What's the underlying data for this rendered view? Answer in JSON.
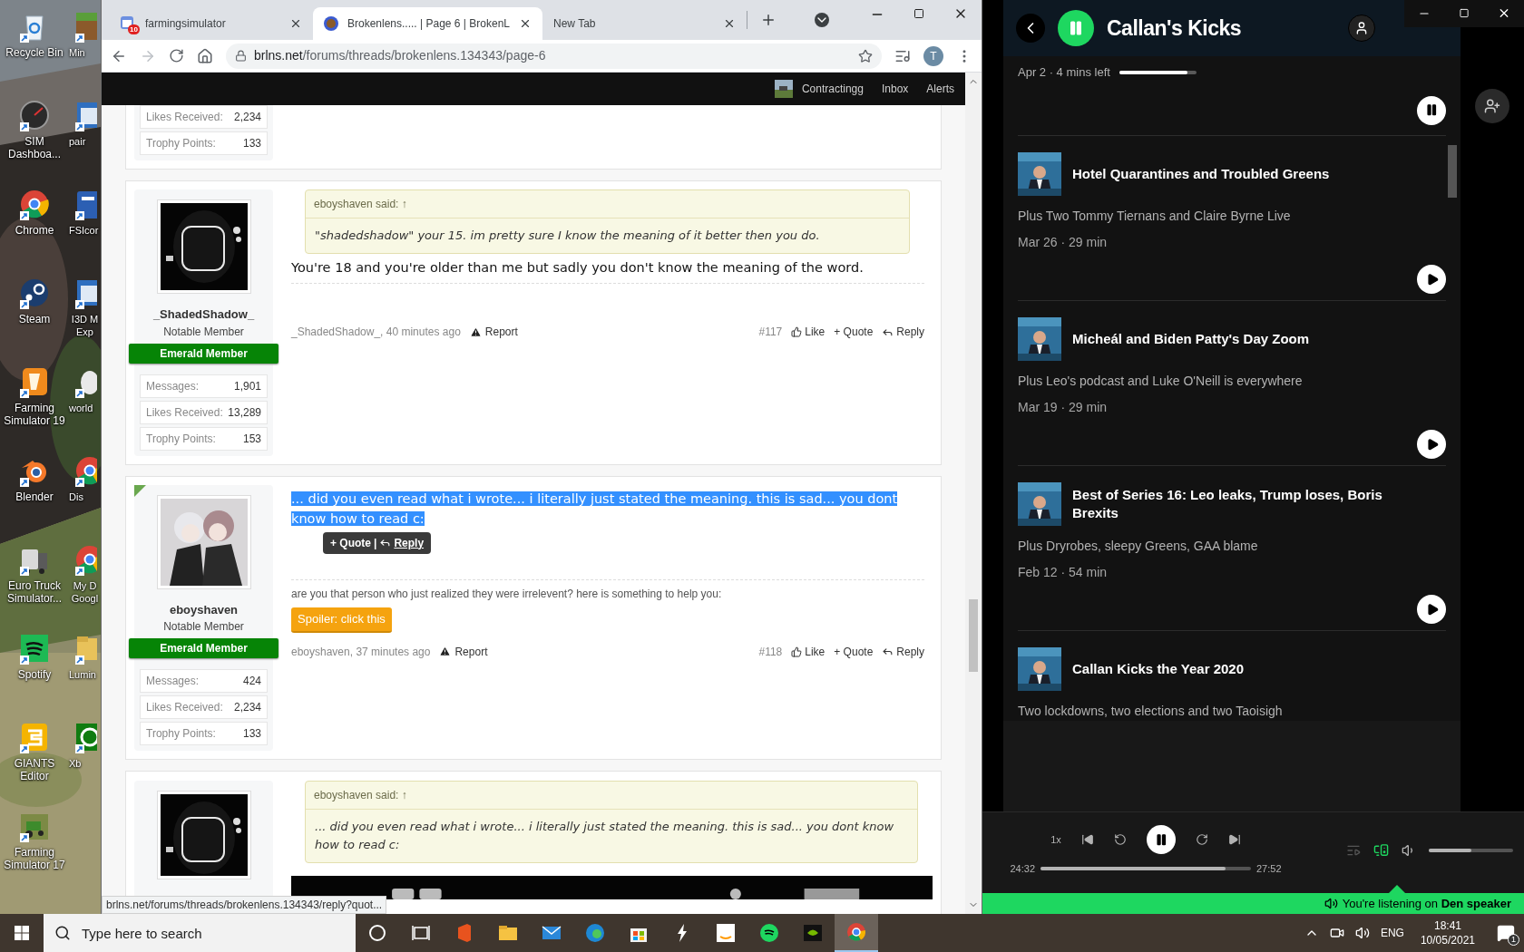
{
  "desktop": {
    "columns": [
      [
        {
          "label": "Recycle Bin",
          "kind": "recycle"
        },
        {
          "label": "SIM Dashboa...",
          "kind": "gauge"
        },
        {
          "label": "Chrome",
          "kind": "chrome"
        },
        {
          "label": "Steam",
          "kind": "steam"
        },
        {
          "label": "Farming Simulator 19",
          "kind": "fs19"
        },
        {
          "label": "Blender",
          "kind": "blender"
        },
        {
          "label": "Euro Truck Simulator...",
          "kind": "truck"
        },
        {
          "label": "Spotify",
          "kind": "spotify"
        },
        {
          "label": "GIANTS Editor",
          "kind": "giants"
        },
        {
          "label": "Farming Simulator 17",
          "kind": "tractor"
        }
      ],
      [
        {
          "label": "Min",
          "kind": "block"
        },
        {
          "label": "pair",
          "kind": "window"
        },
        {
          "label": "FSIcor",
          "kind": "doc"
        },
        {
          "label": "I3D M Exp",
          "kind": "window"
        },
        {
          "label": "world",
          "kind": "mouse"
        },
        {
          "label": "Dis",
          "kind": "chrome"
        },
        {
          "label": "My D Googl",
          "kind": "chrome"
        },
        {
          "label": "Lumin",
          "kind": "folder"
        },
        {
          "label": "Xb",
          "kind": "xbox"
        }
      ]
    ]
  },
  "browser": {
    "tabs": [
      {
        "title": "farmingsimulator",
        "badge": "10",
        "kind": "calendar",
        "selected": false
      },
      {
        "title": "Brokenlens..... | Page 6 | BrokenL",
        "kind": "round",
        "selected": true
      },
      {
        "title": "New Tab",
        "kind": "none",
        "selected": false
      }
    ],
    "address": {
      "domain": "brlns.net",
      "path": "/forums/threads/brokenlens.134343/page-6"
    },
    "profile_initial": "T",
    "site_nav": [
      "Contractingg",
      "Inbox",
      "Alerts"
    ],
    "status_url": "brlns.net/forums/threads/brokenlens.134343/reply?quot..."
  },
  "forum": {
    "posts": [
      {
        "kind": "partial",
        "stats": [
          {
            "label": "Likes Received:",
            "value": "2,234"
          },
          {
            "label": "Trophy Points:",
            "value": "133"
          }
        ]
      },
      {
        "kind": "full",
        "avatar": {
          "kind": "mask"
        },
        "new": false,
        "name": "_ShadedShadow_",
        "title": "Notable Member",
        "banner": "Emerald Member",
        "stats": [
          {
            "label": "Messages:",
            "value": "1,901"
          },
          {
            "label": "Likes Received:",
            "value": "13,289"
          },
          {
            "label": "Trophy Points:",
            "value": "153"
          }
        ],
        "quote": {
          "author": "eboyshaven said: ↑",
          "text": "\"shadedshadow\" your 15. im pretty sure I know the meaning of it better then you do."
        },
        "message": "You're 18 and you're older than me but sadly you don't know the meaning of the word.",
        "selected": false,
        "author_line": "_ShadedShadow_, 40 minutes ago",
        "report": "Report",
        "number": "#117",
        "actions": [
          {
            "kind": "like",
            "label": "Like"
          },
          {
            "kind": "quote",
            "label": "+ Quote"
          },
          {
            "kind": "reply",
            "label": "Reply"
          }
        ]
      },
      {
        "kind": "full",
        "avatar": {
          "kind": "pair"
        },
        "new": true,
        "name": "eboyshaven",
        "title": "Notable Member",
        "banner": "Emerald Member",
        "stats": [
          {
            "label": "Messages:",
            "value": "424"
          },
          {
            "label": "Likes Received:",
            "value": "2,234"
          },
          {
            "label": "Trophy Points:",
            "value": "133"
          }
        ],
        "message": "... did you even read what i wrote... i literally just stated the meaning. this is sad... you dont know how to read c:",
        "selected": true,
        "tooltip": {
          "quote": "+ Quote",
          "separator": "|",
          "reply": "Reply"
        },
        "extra": "are you that person who just realized they were irrelevent? here is something to help you:",
        "spoiler": "Spoiler: click this",
        "author_line": "eboyshaven, 37 minutes ago",
        "report": "Report",
        "number": "#118",
        "actions": [
          {
            "kind": "like",
            "label": "Like"
          },
          {
            "kind": "quote",
            "label": "+ Quote"
          },
          {
            "kind": "reply",
            "label": "Reply"
          }
        ]
      },
      {
        "kind": "cut",
        "avatar": {
          "kind": "mask"
        },
        "quote": {
          "author": "eboyshaven said: ↑",
          "text": "... did you even read what i wrote... i literally just stated the meaning. this is sad... you dont know how to read c:"
        }
      }
    ]
  },
  "spotify": {
    "title": "Callan's Kicks",
    "playing": true,
    "current": {
      "meta": "Apr 2 · 4 mins left",
      "level": 0.88,
      "playing": true
    },
    "episodes": [
      {
        "title": "Hotel Quarantines and Troubled Greens",
        "description": "Plus Two Tommy Tiernans and Claire Byrne Live",
        "meta": "Mar 26 · 29 min"
      },
      {
        "title": "Micheál and Biden Patty's Day Zoom",
        "description": "Plus Leo's podcast and Luke O'Neill is everywhere",
        "meta": "Mar 19 · 29 min"
      },
      {
        "title": "Best of Series 16: Leo leaks, Trump loses, Boris Brexits",
        "description": "Plus Dryrobes, sleepy Greens, GAA blame",
        "meta": "Feb 12 · 54 min"
      },
      {
        "title": "Callan Kicks the Year 2020",
        "description": "Two lockdowns, two elections and two Taoisigh"
      }
    ],
    "player": {
      "speed": "1x",
      "elapsed": "24:32",
      "duration": "27:52",
      "level": 0.88,
      "playing": true,
      "volume": {
        "level": 0.5
      }
    },
    "device_bar": "You're listening on **Den speaker**"
  },
  "taskbar": {
    "search_placeholder": "Type here to search",
    "apps": [
      {
        "kind": "cortana",
        "active": false
      },
      {
        "kind": "taskview",
        "active": false
      },
      {
        "kind": "office",
        "active": false
      },
      {
        "kind": "explorer",
        "active": false
      },
      {
        "kind": "mail",
        "active": false
      },
      {
        "kind": "edge",
        "active": false
      },
      {
        "kind": "store",
        "active": false
      },
      {
        "kind": "bolt",
        "active": false
      },
      {
        "kind": "amazon",
        "active": false
      },
      {
        "kind": "spotify",
        "active": false
      },
      {
        "kind": "nvidia",
        "active": false
      },
      {
        "kind": "chrome",
        "active": true
      }
    ],
    "language": "ENG",
    "time": "18:41",
    "date": "10/05/2021",
    "notifications": "1"
  }
}
